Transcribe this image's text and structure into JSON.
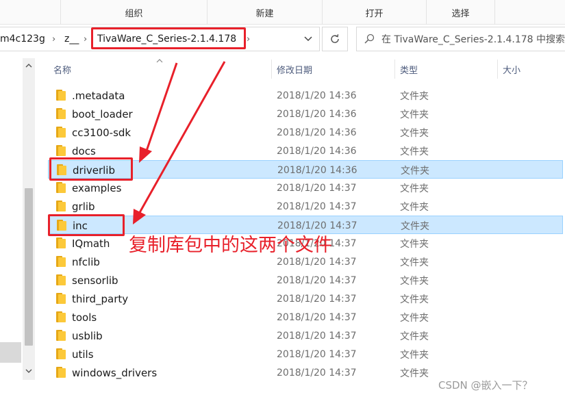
{
  "ribbon": {
    "groups": [
      "组织",
      "新建",
      "打开",
      "选择"
    ]
  },
  "address": {
    "crumbs": [
      "m4c123g",
      "z__",
      "TivaWare_C_Series-2.1.4.178"
    ],
    "separator": "›",
    "dropdown_icon": "chevron-down-icon",
    "refresh_icon": "refresh-icon"
  },
  "search": {
    "placeholder": "在 TivaWare_C_Series-2.1.4.178 中搜索",
    "icon": "search-icon"
  },
  "columns": {
    "name": "名称",
    "date": "修改日期",
    "type": "类型",
    "size": "大小"
  },
  "files": [
    {
      "name": ".metadata",
      "date": "2018/1/20 14:36",
      "type": "文件夹",
      "selected": false
    },
    {
      "name": "boot_loader",
      "date": "2018/1/20 14:36",
      "type": "文件夹",
      "selected": false
    },
    {
      "name": "cc3100-sdk",
      "date": "2018/1/20 14:36",
      "type": "文件夹",
      "selected": false
    },
    {
      "name": "docs",
      "date": "2018/1/20 14:36",
      "type": "文件夹",
      "selected": false
    },
    {
      "name": "driverlib",
      "date": "2018/1/20 14:36",
      "type": "文件夹",
      "selected": true
    },
    {
      "name": "examples",
      "date": "2018/1/20 14:37",
      "type": "文件夹",
      "selected": false
    },
    {
      "name": "grlib",
      "date": "2018/1/20 14:37",
      "type": "文件夹",
      "selected": false
    },
    {
      "name": "inc",
      "date": "2018/1/20 14:37",
      "type": "文件夹",
      "selected": true
    },
    {
      "name": "IQmath",
      "date": "2018/1/20 14:37",
      "type": "文件夹",
      "selected": false
    },
    {
      "name": "nfclib",
      "date": "2018/1/20 14:37",
      "type": "文件夹",
      "selected": false
    },
    {
      "name": "sensorlib",
      "date": "2018/1/20 14:37",
      "type": "文件夹",
      "selected": false
    },
    {
      "name": "third_party",
      "date": "2018/1/20 14:37",
      "type": "文件夹",
      "selected": false
    },
    {
      "name": "tools",
      "date": "2018/1/20 14:37",
      "type": "文件夹",
      "selected": false
    },
    {
      "name": "usblib",
      "date": "2018/1/20 14:37",
      "type": "文件夹",
      "selected": false
    },
    {
      "name": "utils",
      "date": "2018/1/20 14:37",
      "type": "文件夹",
      "selected": false
    },
    {
      "name": "windows_drivers",
      "date": "2018/1/20 14:37",
      "type": "文件夹",
      "selected": false
    }
  ],
  "annotation": {
    "text": "复制库包中的这两个文件"
  },
  "watermark": "CSDN @嵌入一下？",
  "colors": {
    "highlight": "#e8202a",
    "selection": "#cce8ff",
    "folder": "#fcc93a"
  }
}
